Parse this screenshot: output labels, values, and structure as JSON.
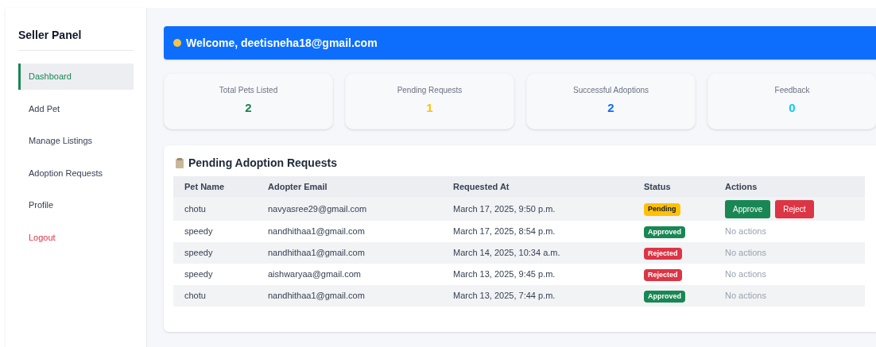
{
  "sidebar": {
    "title": "Seller Panel",
    "items": [
      {
        "label": "Dashboard",
        "selected": true,
        "kind": "link"
      },
      {
        "label": "Add Pet",
        "selected": false,
        "kind": "link"
      },
      {
        "label": "Manage Listings",
        "selected": false,
        "kind": "link"
      },
      {
        "label": "Adoption Requests",
        "selected": false,
        "kind": "link"
      },
      {
        "label": "Profile",
        "selected": false,
        "kind": "link"
      },
      {
        "label": "Logout",
        "selected": false,
        "kind": "danger"
      }
    ]
  },
  "welcome": "Welcome, deetisneha18@gmail.com",
  "stats": [
    {
      "label": "Total Pets Listed",
      "value": "2",
      "color": "#198754"
    },
    {
      "label": "Pending Requests",
      "value": "1",
      "color": "#ffc107"
    },
    {
      "label": "Successful Adoptions",
      "value": "2",
      "color": "#0d6efd"
    },
    {
      "label": "Feedback",
      "value": "0",
      "color": "#0dcaf0"
    }
  ],
  "table": {
    "title": "Pending Adoption Requests",
    "columns": [
      "Pet Name",
      "Adopter Email",
      "Requested At",
      "Status",
      "Actions"
    ],
    "rows": [
      {
        "pet": "chotu",
        "email": "navyasree29@gmail.com",
        "requested": "March 17, 2025, 9:50 p.m.",
        "status": {
          "label": "Pending",
          "kind": "pending"
        },
        "actions": [
          {
            "label": "Approve",
            "kind": "approve"
          },
          {
            "label": "Reject",
            "kind": "reject"
          }
        ]
      },
      {
        "pet": "speedy",
        "email": "nandhithaa1@gmail.com",
        "requested": "March 17, 2025, 8:54 p.m.",
        "status": {
          "label": "Approved",
          "kind": "approved"
        },
        "note": "No actions"
      },
      {
        "pet": "speedy",
        "email": "nandhithaa1@gmail.com",
        "requested": "March 14, 2025, 10:34 a.m.",
        "status": {
          "label": "Rejected",
          "kind": "rejected"
        },
        "note": "No actions"
      },
      {
        "pet": "speedy",
        "email": "aishwaryaa@gmail.com",
        "requested": "March 13, 2025, 9:45 p.m.",
        "status": {
          "label": "Rejected",
          "kind": "rejected"
        },
        "note": "No actions"
      },
      {
        "pet": "chotu",
        "email": "nandhithaa1@gmail.com",
        "requested": "March 13, 2025, 7:44 p.m.",
        "status": {
          "label": "Approved",
          "kind": "approved"
        },
        "note": "No actions"
      }
    ]
  }
}
